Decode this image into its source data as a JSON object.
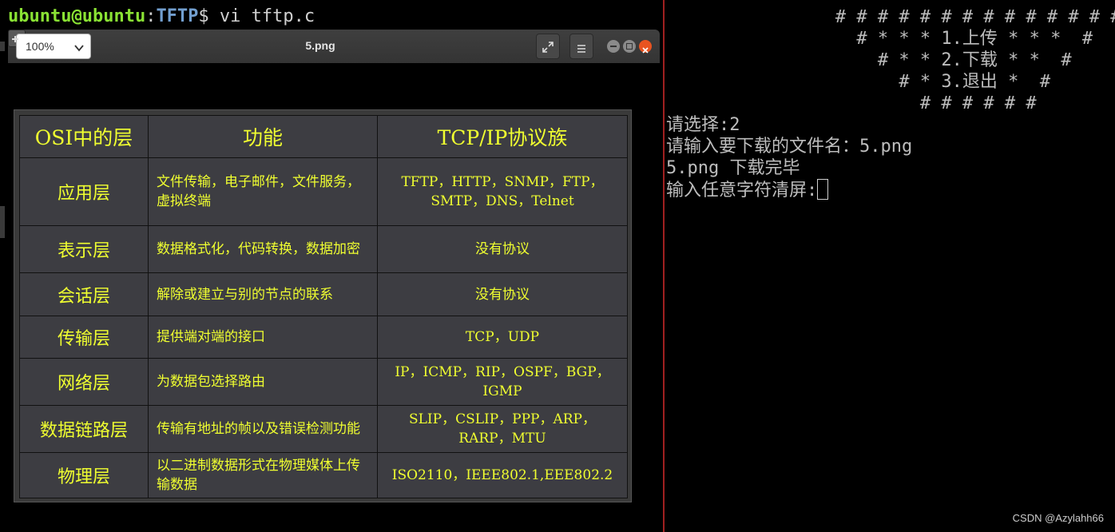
{
  "left_terminal": {
    "prompt": {
      "user_host": "ubuntu@ubuntu",
      "colon": ":",
      "path": "TFTP",
      "dollar": "$",
      "command": " vi tftp.c"
    }
  },
  "viewer": {
    "zoom": "100%",
    "title": "5.png",
    "icons": {
      "zoom_dropdown": "chevron-down-icon",
      "add": "plus-icon",
      "fullscreen": "expand-icon",
      "menu": "hamburger-icon"
    },
    "table": {
      "headers": [
        "OSI中的层",
        "功能",
        "TCP/IP协议族"
      ],
      "rows": [
        {
          "layer": "应用层",
          "function": "文件传输，电子邮件，文件服务，虚拟终端",
          "protocols": "TFTP，HTTP，SNMP，FTP，SMTP，DNS，Telnet"
        },
        {
          "layer": "表示层",
          "function": "数据格式化，代码转换，数据加密",
          "protocols": "没有协议"
        },
        {
          "layer": "会话层",
          "function": "解除或建立与别的节点的联系",
          "protocols": "没有协议"
        },
        {
          "layer": "传输层",
          "function": "提供端对端的接口",
          "protocols": "TCP，UDP"
        },
        {
          "layer": "网络层",
          "function": "为数据包选择路由",
          "protocols": "IP，ICMP，RIP，OSPF，BGP，IGMP"
        },
        {
          "layer": "数据链路层",
          "function": "传输有地址的帧以及错误检测功能",
          "protocols": "SLIP，CSLIP，PPP，ARP，RARP，MTU"
        },
        {
          "layer": "物理层",
          "function": "以二进制数据形式在物理媒体上传输数据",
          "protocols": "ISO2110，IEEE802.1,EEE802.2"
        }
      ]
    }
  },
  "right_terminal": {
    "menu": [
      "                # # # # # # # # # # # # # #",
      "                  # * * * 1.上传 * * *  #",
      "                    # * * 2.下载 * *  #",
      "                      # * 3.退出 *  #",
      "                        # # # # # #"
    ],
    "output": [
      "请选择:2",
      "请输入要下载的文件名：5.png",
      "5.png 下载完毕",
      "输入任意字符清屏:"
    ]
  },
  "watermark": "CSDN @Azylahh66",
  "colors": {
    "prompt_user": "#8ae234",
    "prompt_path": "#729fcf",
    "table_text": "#f0ff30",
    "close_button": "#e95420",
    "divider": "#a02020"
  }
}
